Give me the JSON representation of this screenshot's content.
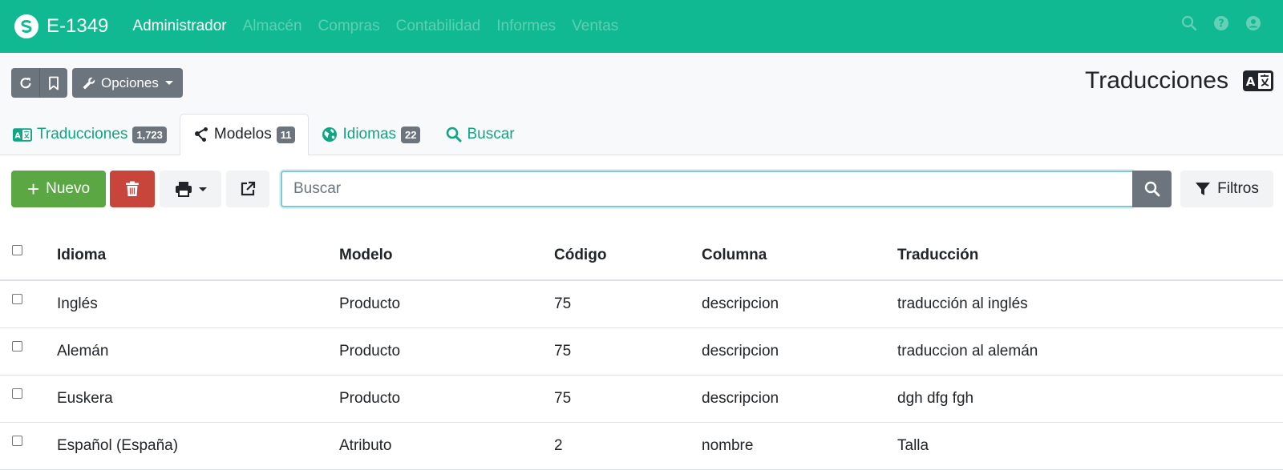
{
  "navbar": {
    "brand": "E-1349",
    "items": [
      {
        "label": "Administrador",
        "active": true
      },
      {
        "label": "Almacén",
        "active": false
      },
      {
        "label": "Compras",
        "active": false
      },
      {
        "label": "Contabilidad",
        "active": false
      },
      {
        "label": "Informes",
        "active": false
      },
      {
        "label": "Ventas",
        "active": false
      }
    ],
    "right_icons": [
      "search-icon",
      "help-icon",
      "user-icon"
    ],
    "color": "#10b991"
  },
  "header": {
    "title": "Traducciones",
    "title_icon": "language-icon",
    "buttons": {
      "reload_icon": "reload-icon",
      "bookmark_icon": "bookmark-icon",
      "options_label": "Opciones"
    }
  },
  "tabs": [
    {
      "label": "Traducciones",
      "count": "1,723",
      "icon": "language-icon",
      "active": false
    },
    {
      "label": "Modelos",
      "count": "11",
      "icon": "share-nodes-icon",
      "active": true
    },
    {
      "label": "Idiomas",
      "count": "22",
      "icon": "globe-icon",
      "active": false
    },
    {
      "label": "Buscar",
      "count": null,
      "icon": "search-icon",
      "active": false
    }
  ],
  "toolbar": {
    "new_label": "Nuevo",
    "search_placeholder": "Buscar",
    "search_value": "",
    "filters_label": "Filtros",
    "colors": {
      "new": "#5ba744",
      "delete": "#c7453b"
    }
  },
  "table": {
    "columns": [
      "Idioma",
      "Modelo",
      "Código",
      "Columna",
      "Traducción"
    ],
    "rows": [
      [
        "Inglés",
        "Producto",
        "75",
        "descripcion",
        "traducción al inglés"
      ],
      [
        "Alemán",
        "Producto",
        "75",
        "descripcion",
        "traduccion al alemán"
      ],
      [
        "Euskera",
        "Producto",
        "75",
        "descripcion",
        "dgh dfg fgh"
      ],
      [
        "Español (España)",
        "Atributo",
        "2",
        "nombre",
        "Talla"
      ]
    ]
  }
}
